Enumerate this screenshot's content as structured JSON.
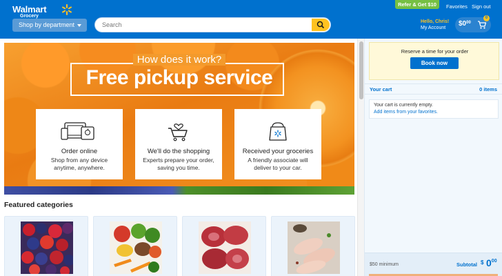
{
  "header": {
    "logo_word": "Walmart",
    "logo_sub": "Grocery",
    "dept_label": "Shop by department",
    "search_placeholder": "Search",
    "refer_label": "Refer & Get $10",
    "favorites_label": "Favorites",
    "signout_label": "Sign out",
    "hello_text": "Hello, Chris!",
    "account_label": "My Account",
    "cart_total": "$0",
    "cart_cents": "00",
    "cart_count": "0"
  },
  "hero": {
    "subtitle": "How does it work?",
    "title": "Free pickup service",
    "cards": [
      {
        "title": "Order online",
        "desc": "Shop from any device anytime, anywhere.",
        "icon": "devices-icon"
      },
      {
        "title": "We'll do the shopping",
        "desc": "Experts prepare your order, saving you time.",
        "icon": "heart-cart-icon"
      },
      {
        "title": "Received your groceries",
        "desc": "A friendly associate will deliver to your car.",
        "icon": "grocery-bag-icon"
      }
    ]
  },
  "featured": {
    "heading": "Featured categories",
    "tiles": [
      {
        "icon": "berries-image"
      },
      {
        "icon": "vegetables-image"
      },
      {
        "icon": "meat-image"
      },
      {
        "icon": "chicken-image"
      }
    ]
  },
  "sidebar": {
    "reserve_text": "Reserve a time for your order",
    "book_label": "Book now",
    "cart_label": "Your cart",
    "cart_items": "0 items",
    "empty_text": "Your cart is currently empty.",
    "favorites_link": "Add items from your favorites.",
    "minimum": "$50 minimum",
    "subtotal_label": "Subtotal",
    "subtotal_dollar": "$",
    "subtotal_value": "0",
    "subtotal_cents": "00"
  },
  "colors": {
    "brand_blue": "#0071ce",
    "accent_yellow": "#ffc220",
    "refer_green": "#76c043"
  }
}
